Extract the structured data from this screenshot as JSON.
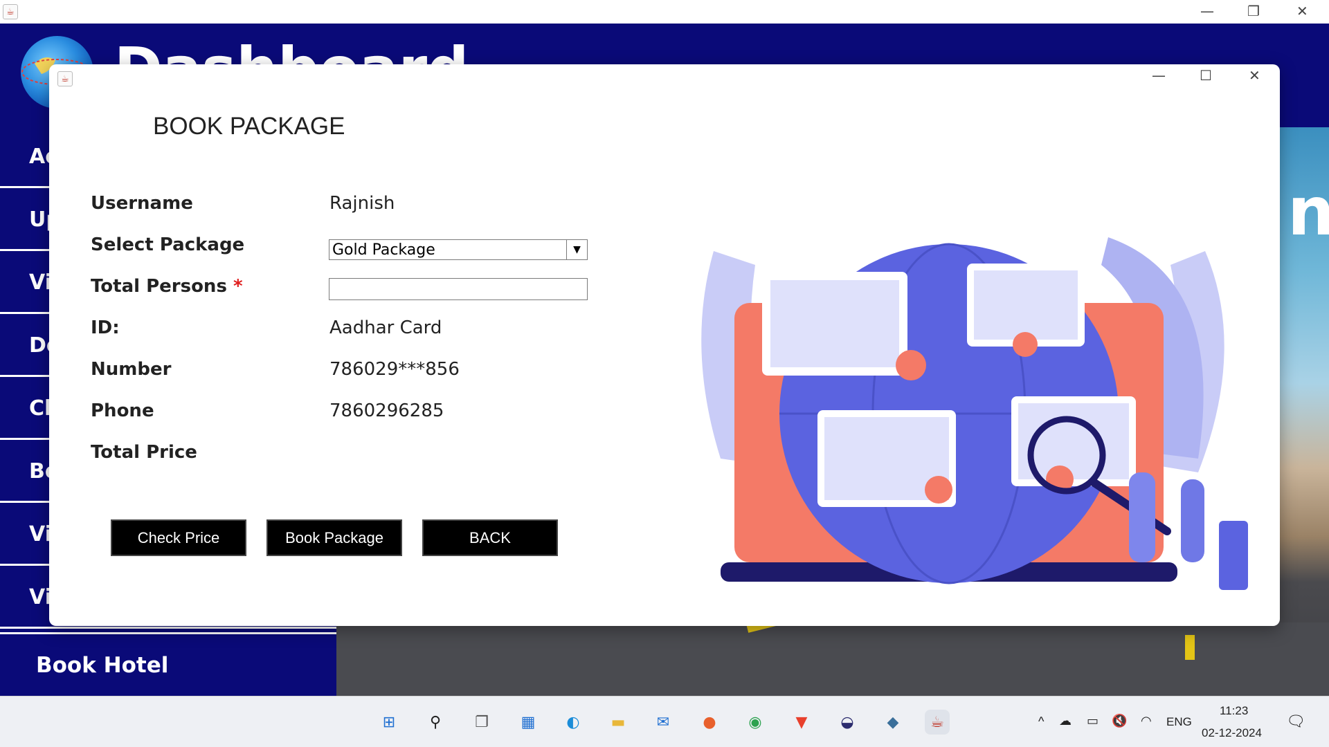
{
  "outer_window": {
    "controls": {
      "minimize": "—",
      "restore": "❐",
      "close": "✕"
    }
  },
  "dashboard": {
    "title": "Dashboard",
    "sidebar_partial": [
      "Ac",
      "Up",
      "Vi",
      "De",
      "Cl",
      "Bo",
      "Vi",
      "Vi"
    ],
    "sidebar_book_hotel": "Book Hotel",
    "background_text": "na"
  },
  "dialog": {
    "controls": {
      "minimize": "—",
      "maximize": "☐",
      "close": "✕"
    },
    "title": "BOOK PACKAGE",
    "fields": {
      "username_label": "Username",
      "username_value": "Rajnish",
      "package_label": "Select Package",
      "package_value": "Gold Package",
      "persons_label": "Total Persons",
      "persons_required": "*",
      "persons_value": "",
      "id_label": "ID:",
      "id_value": "Aadhar Card",
      "number_label": "Number",
      "number_value": "786029***856",
      "phone_label": "Phone",
      "phone_value": "7860296285",
      "price_label": "Total Price",
      "price_value": ""
    },
    "buttons": {
      "check_price": "Check Price",
      "book_package": "Book Package",
      "back": "BACK"
    }
  },
  "taskbar": {
    "tray": {
      "language": "ENG",
      "time": "11:23",
      "date": "02-12-2024"
    }
  },
  "colors": {
    "dashboard_blue": "#0a0a78",
    "button_black": "#000000",
    "required_red": "#e02020",
    "illustration_blue": "#5b63e0",
    "illustration_coral": "#f47a67"
  }
}
